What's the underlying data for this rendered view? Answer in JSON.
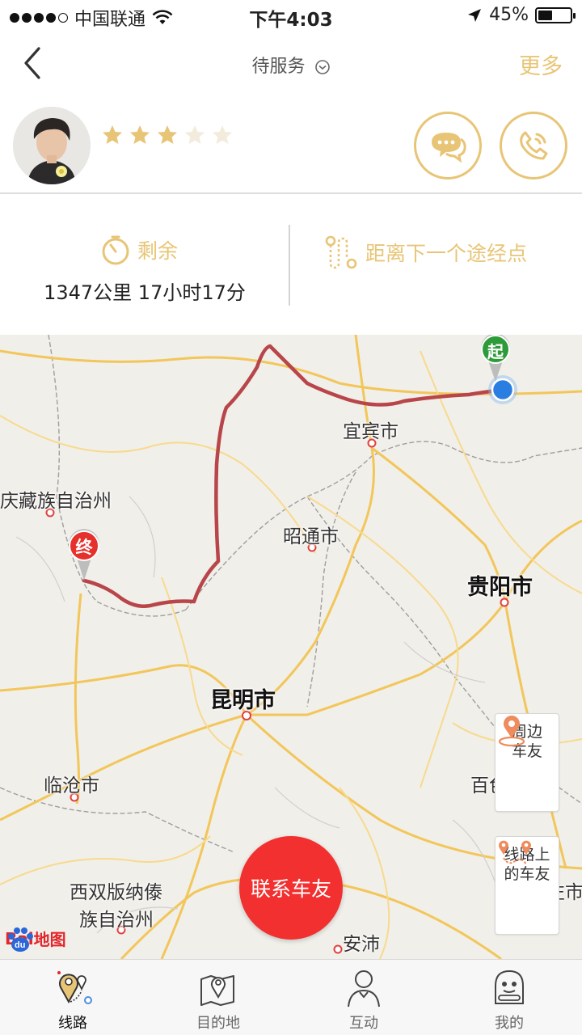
{
  "status_bar": {
    "carrier": "中国联通",
    "time": "下午4:03",
    "battery_text": "45%",
    "battery_level": 0.45
  },
  "nav": {
    "title": "待服务",
    "more_label": "更多"
  },
  "driver": {
    "rating": 3,
    "rating_max": 5,
    "accent_color": "#e8c576"
  },
  "trip": {
    "remaining_label": "剩余",
    "remaining_value": "1347公里  17小时17分",
    "next_waypoint_label": "距离下一个途经点"
  },
  "map": {
    "markers": {
      "start": "起",
      "end": "终"
    },
    "cities": {
      "yibin": "宜宾市",
      "ganzi": "庆藏族自治州",
      "zhaotong": "昭通市",
      "guiyang": "贵阳市",
      "kunming": "昆明市",
      "lincang": "临沧市",
      "baise": "百色市",
      "xishuangbanna_1": "西双版纳傣",
      "xishuangbanna_2": "族自治州",
      "anshun": "安沛",
      "edge_right": "左市"
    },
    "nearby_riders": "周边车友",
    "nearby_riders_line1": "周边",
    "nearby_riders_line2": "车友",
    "route_riders_line1": "线路上",
    "route_riders_line2": "的车友",
    "contact_button": "联系车友",
    "logo_text_1": "Bai",
    "logo_text_2": "地图",
    "route_color": "#b8454a",
    "road_color": "#f2c65a"
  },
  "tabs": [
    {
      "label": "线路",
      "icon": "route-pin-icon",
      "active": true
    },
    {
      "label": "目的地",
      "icon": "map-pin-icon",
      "active": false
    },
    {
      "label": "互动",
      "icon": "person-icon",
      "active": false
    },
    {
      "label": "我的",
      "icon": "mascot-icon",
      "active": false
    }
  ]
}
